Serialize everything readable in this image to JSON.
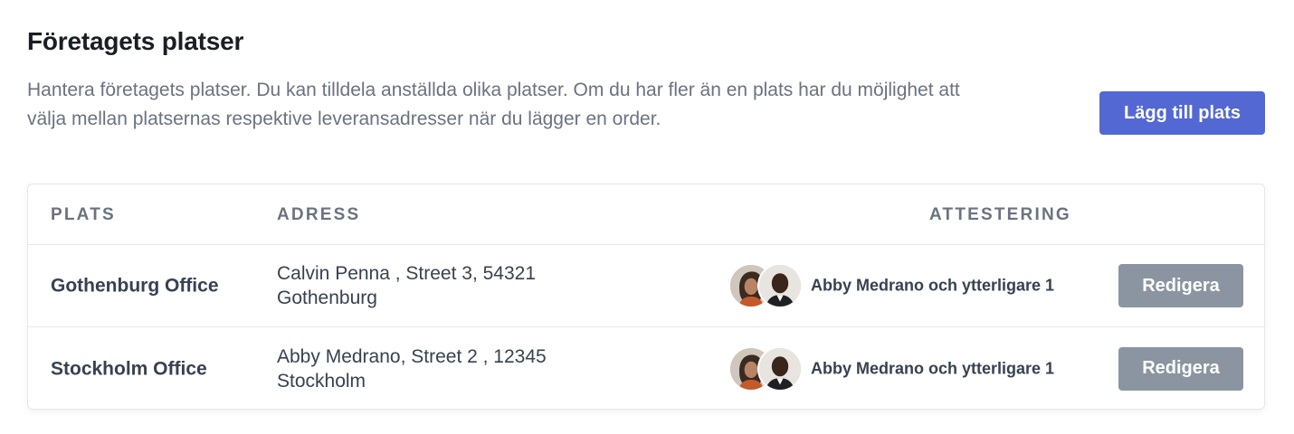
{
  "header": {
    "title": "Företagets platser",
    "description": "Hantera företagets platser. Du kan tilldela anställda olika platser. Om du har fler än en plats har du möjlighet att välja mellan platsernas respektive leveransadresser när du lägger en order.",
    "add_button_label": "Lägg till plats"
  },
  "colors": {
    "primary": "#5468d4",
    "secondary_button": "#8b95a1",
    "muted_text": "#6b7280"
  },
  "table": {
    "columns": {
      "plats": "PLATS",
      "adress": "ADRESS",
      "attestering": "ATTESTERING"
    },
    "rows": [
      {
        "name": "Gothenburg Office",
        "address": "Calvin Penna , Street 3, 54321 Gothenburg",
        "approver": "Abby Medrano och ytterligare 1",
        "edit_label": "Redigera"
      },
      {
        "name": "Stockholm Office",
        "address": "Abby Medrano, Street 2 , 12345 Stockholm",
        "approver": "Abby Medrano och ytterligare 1",
        "edit_label": "Redigera"
      }
    ]
  }
}
